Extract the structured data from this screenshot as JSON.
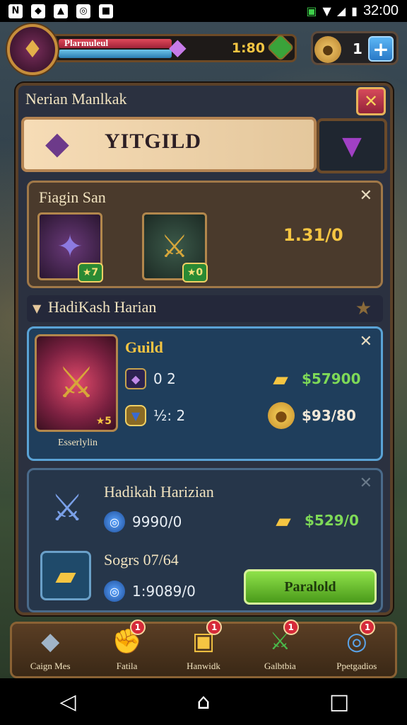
{
  "status_bar": {
    "left_icons": [
      "N",
      "shield",
      "pin",
      "ring",
      "square"
    ],
    "time": "32:00"
  },
  "hud": {
    "player_name": "Plarmuleul",
    "xp_value": "1:80",
    "currency_value": "1"
  },
  "panel": {
    "title": "Nerian Manlkak",
    "banner_text": "YITGILD",
    "card1": {
      "title": "Fiagin San",
      "hero_a_badge": "7",
      "hero_b_badge": "0",
      "value": "1.31/0"
    },
    "section": {
      "title": "HadiKash Harian"
    },
    "card2": {
      "title": "Guild",
      "hero_stars": "5",
      "hero_caption": "Esserlylin",
      "stat1": "0 2",
      "stat2": "½: 2",
      "money1": "$57900",
      "money2": "$93/80"
    },
    "card3": {
      "title": "Hadikah Harizian",
      "stat1": "9990/0",
      "money1": "$529/0",
      "subtitle": "Sogrs 07/64",
      "stat2": "1:9089/0",
      "button": "Paralold"
    }
  },
  "tabs": [
    {
      "label": "Caign Mes",
      "badge": ""
    },
    {
      "label": "Fatila",
      "badge": "1"
    },
    {
      "label": "Hanwidk",
      "badge": "1"
    },
    {
      "label": "Galbtbia",
      "badge": "1"
    },
    {
      "label": "Ppetgadios",
      "badge": "1"
    }
  ]
}
